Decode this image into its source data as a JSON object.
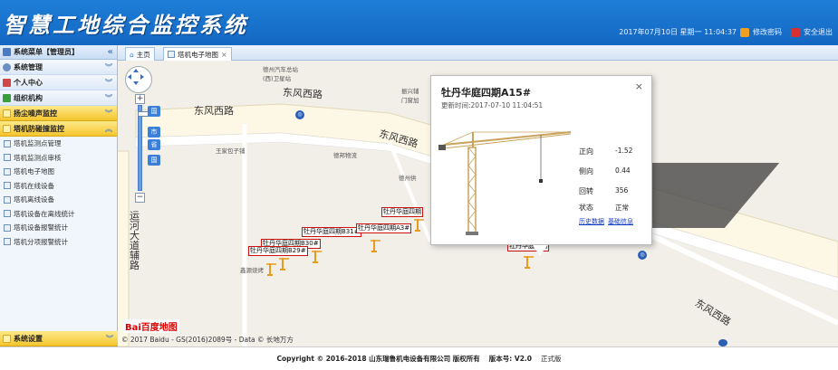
{
  "header": {
    "app_title": "智慧工地综合监控系统",
    "datetime": "2017年07月10日 星期一 11:04:37",
    "change_password": "修改密码",
    "safe_exit": "安全退出"
  },
  "sidebar": {
    "header": "系统菜单【管理员】",
    "groups": [
      {
        "label": "系统管理"
      },
      {
        "label": "个人中心"
      },
      {
        "label": "组织机构"
      },
      {
        "label": "扬尘噪声监控"
      },
      {
        "label": "塔机防碰撞监控"
      }
    ],
    "sub_items": [
      {
        "label": "塔机监测点管理"
      },
      {
        "label": "塔机监测点审核"
      },
      {
        "label": "塔机电子地图"
      },
      {
        "label": "塔机在线设备"
      },
      {
        "label": "塔机离线设备"
      },
      {
        "label": "塔机设备在离线统计"
      },
      {
        "label": "塔机设备报警统计"
      },
      {
        "label": "塔机分项报警统计"
      }
    ],
    "bottom_group": "系统设置"
  },
  "tabs": [
    {
      "label": "主页"
    },
    {
      "label": "塔机电子地图"
    }
  ],
  "map": {
    "roads": {
      "r1": "东风西路",
      "r2": "东风西路",
      "r3": "东风西路",
      "r4": "东风西路",
      "vertical": "运河大道辅路"
    },
    "pois": {
      "p1": "德州汽车总站\n(西)卫星站",
      "p2": "振兴辅\n门窗加",
      "p3": "王家包子铺",
      "p4": "德邦物流",
      "p5": "德州供",
      "p6": "鑫源烧烤"
    },
    "zoom_tags": [
      "国",
      "市",
      "省",
      "国"
    ],
    "cranes": {
      "c1": "牡丹华庭四期",
      "c2": "牡丹华庭四期B31#",
      "c3": "牡丹华庭四期A3#",
      "c4": "牡丹华庭四期B30#",
      "c5": "牡丹华庭四期B29#",
      "c6": "牡丹华庭四期"
    },
    "copyright": "© 2017 Baidu - GS(2016)2089号 - Data © 长地万方",
    "baidu_logo": "Bai百度地图"
  },
  "popup": {
    "title": "牡丹华庭四期A15#",
    "updated": "更新时间:2017-07-10 11:04:51",
    "stats": [
      {
        "label": "正向",
        "value": "-1.52"
      },
      {
        "label": "侧向",
        "value": "0.44"
      },
      {
        "label": "回转",
        "value": "356"
      },
      {
        "label": "状态",
        "value": "正常"
      }
    ],
    "link_history": "历史数据",
    "link_basic": "基础信息"
  },
  "footer": {
    "copyright": "Copyright © 2016-2018 山东瑞鲁机电设备有限公司 版权所有",
    "version": "版本号: V2.0",
    "edition": "正式版"
  },
  "colors": {
    "header_blue": "#1a72cd",
    "menu_yellow": "#f5c52e",
    "label_red": "#cc1111",
    "link_blue": "#1238c8"
  }
}
